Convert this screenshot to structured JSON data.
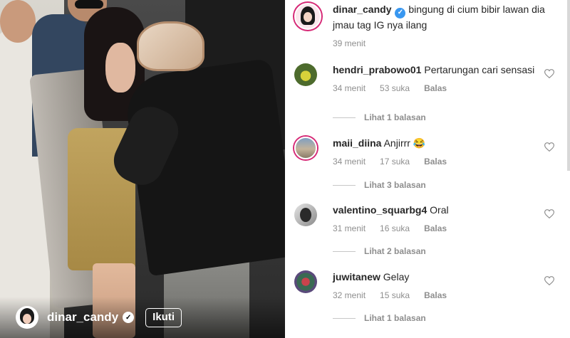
{
  "post": {
    "author": "dinar_candy",
    "follow_label": "Ikuti"
  },
  "caption": {
    "username": "dinar_candy",
    "text": "bingung di cium bibir lawan dia jmau tag IG nya ilang",
    "time": "39 menit"
  },
  "comments": [
    {
      "username": "hendri_prabowo01",
      "text": "Pertarungan cari sensasi",
      "time": "34 menit",
      "likes": "53 suka",
      "reply_label": "Balas",
      "view_replies": "Lihat 1 balasan"
    },
    {
      "username": "maii_diina",
      "text": "Anjirrr 😂",
      "time": "34 menit",
      "likes": "17 suka",
      "reply_label": "Balas",
      "view_replies": "Lihat 3 balasan"
    },
    {
      "username": "valentino_squarbg4",
      "text": "Oral",
      "time": "31 menit",
      "likes": "16 suka",
      "reply_label": "Balas",
      "view_replies": "Lihat 2 balasan"
    },
    {
      "username": "juwitanew",
      "text": "Gelay",
      "time": "32 menit",
      "likes": "15 suka",
      "reply_label": "Balas",
      "view_replies": "Lihat 1 balasan"
    }
  ],
  "colors": {
    "verified": "#3897f0",
    "story_ring": "#d62976",
    "muted_text": "#8e8e8e"
  },
  "icons": [
    "verified-badge-icon",
    "heart-icon"
  ]
}
